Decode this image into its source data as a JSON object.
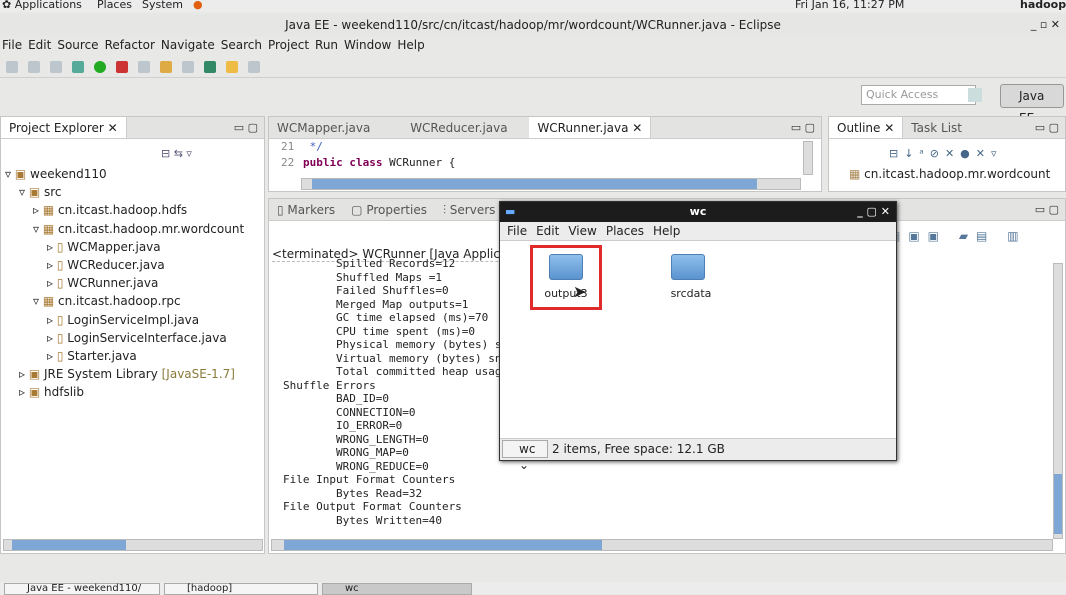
{
  "top_panel": {
    "menus": [
      "Applications",
      "Places",
      "System"
    ],
    "clock": "Fri Jan 16, 11:27 PM",
    "user": "hadoop"
  },
  "window": {
    "title": "Java EE - weekend110/src/cn/itcast/hadoop/mr/wordcount/WCRunner.java - Eclipse"
  },
  "menu": [
    "File",
    "Edit",
    "Source",
    "Refactor",
    "Navigate",
    "Search",
    "Project",
    "Run",
    "Window",
    "Help"
  ],
  "quick_access": {
    "placeholder": "Quick Access"
  },
  "perspective": "Java EE",
  "project_explorer": {
    "title": "Project Explorer",
    "tree": [
      {
        "label": "weekend110",
        "depth": 0,
        "open": true
      },
      {
        "label": "src",
        "depth": 1,
        "open": true
      },
      {
        "label": "cn.itcast.hadoop.hdfs",
        "depth": 2,
        "open": false
      },
      {
        "label": "cn.itcast.hadoop.mr.wordcount",
        "depth": 2,
        "open": true
      },
      {
        "label": "WCMapper.java",
        "depth": 3,
        "open": false
      },
      {
        "label": "WCReducer.java",
        "depth": 3,
        "open": false
      },
      {
        "label": "WCRunner.java",
        "depth": 3,
        "open": false
      },
      {
        "label": "cn.itcast.hadoop.rpc",
        "depth": 2,
        "open": true
      },
      {
        "label": "LoginServiceImpl.java",
        "depth": 3,
        "open": false
      },
      {
        "label": "LoginServiceInterface.java",
        "depth": 3,
        "open": false
      },
      {
        "label": "Starter.java",
        "depth": 3,
        "open": false
      },
      {
        "label": "JRE System Library",
        "suffix": "[JavaSE-1.7]",
        "depth": 1,
        "open": false
      },
      {
        "label": "hdfslib",
        "depth": 1,
        "open": false
      }
    ]
  },
  "editor": {
    "tabs": [
      "WCMapper.java",
      "WCReducer.java",
      "WCRunner.java"
    ],
    "active": 2,
    "lines": [
      {
        "num": "21",
        "text": " */"
      },
      {
        "num": "22",
        "kw": "public class",
        "text": " WCRunner {"
      }
    ]
  },
  "outline": {
    "tabs": [
      "Outline",
      "Task List"
    ],
    "item": "cn.itcast.hadoop.mr.wordcount"
  },
  "console": {
    "tabs": [
      "Markers",
      "Properties",
      "Servers",
      "Da"
    ],
    "header": "<terminated> WCRunner [Java Application] /",
    "lines": [
      "        Spilled Records=12",
      "        Shuffled Maps =1",
      "        Failed Shuffles=0",
      "        Merged Map outputs=1",
      "        GC time elapsed (ms)=70",
      "        CPU time spent (ms)=0",
      "        Physical memory (bytes) snapshot",
      "        Virtual memory (bytes) snapshot",
      "        Total committed heap usage",
      "Shuffle Errors",
      "        BAD_ID=0",
      "        CONNECTION=0",
      "        IO_ERROR=0",
      "        WRONG_LENGTH=0",
      "        WRONG_MAP=0",
      "        WRONG_REDUCE=0",
      "File Input Format Counters",
      "        Bytes Read=32",
      "File Output Format Counters",
      "        Bytes Written=40"
    ]
  },
  "file_manager": {
    "title": "wc",
    "menu": [
      "File",
      "Edit",
      "View",
      "Places",
      "Help"
    ],
    "items": [
      "output3",
      "srcdata"
    ],
    "selected": "output3",
    "location": "wc",
    "status": "2 items, Free space: 12.1 GB"
  },
  "taskbar": [
    "Java EE - weekend110/",
    "[hadoop]",
    "wc"
  ]
}
